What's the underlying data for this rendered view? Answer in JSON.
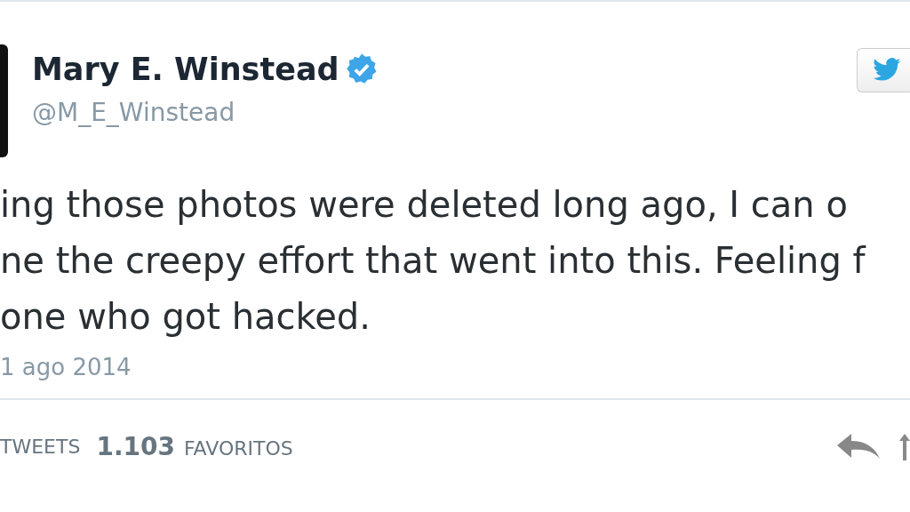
{
  "author": {
    "name": "Mary E. Winstead",
    "verified": true,
    "handle": "@M_E_Winstead"
  },
  "tweet": {
    "lines": [
      "ing those photos were deleted long ago, I can o",
      "ne the creepy effort that went into this. Feeling f",
      "one who got hacked."
    ],
    "date": "1 ago 2014"
  },
  "stats": [
    {
      "label": "TWEETS"
    },
    {
      "count": "1.103",
      "label": "FAVORITOS"
    }
  ]
}
